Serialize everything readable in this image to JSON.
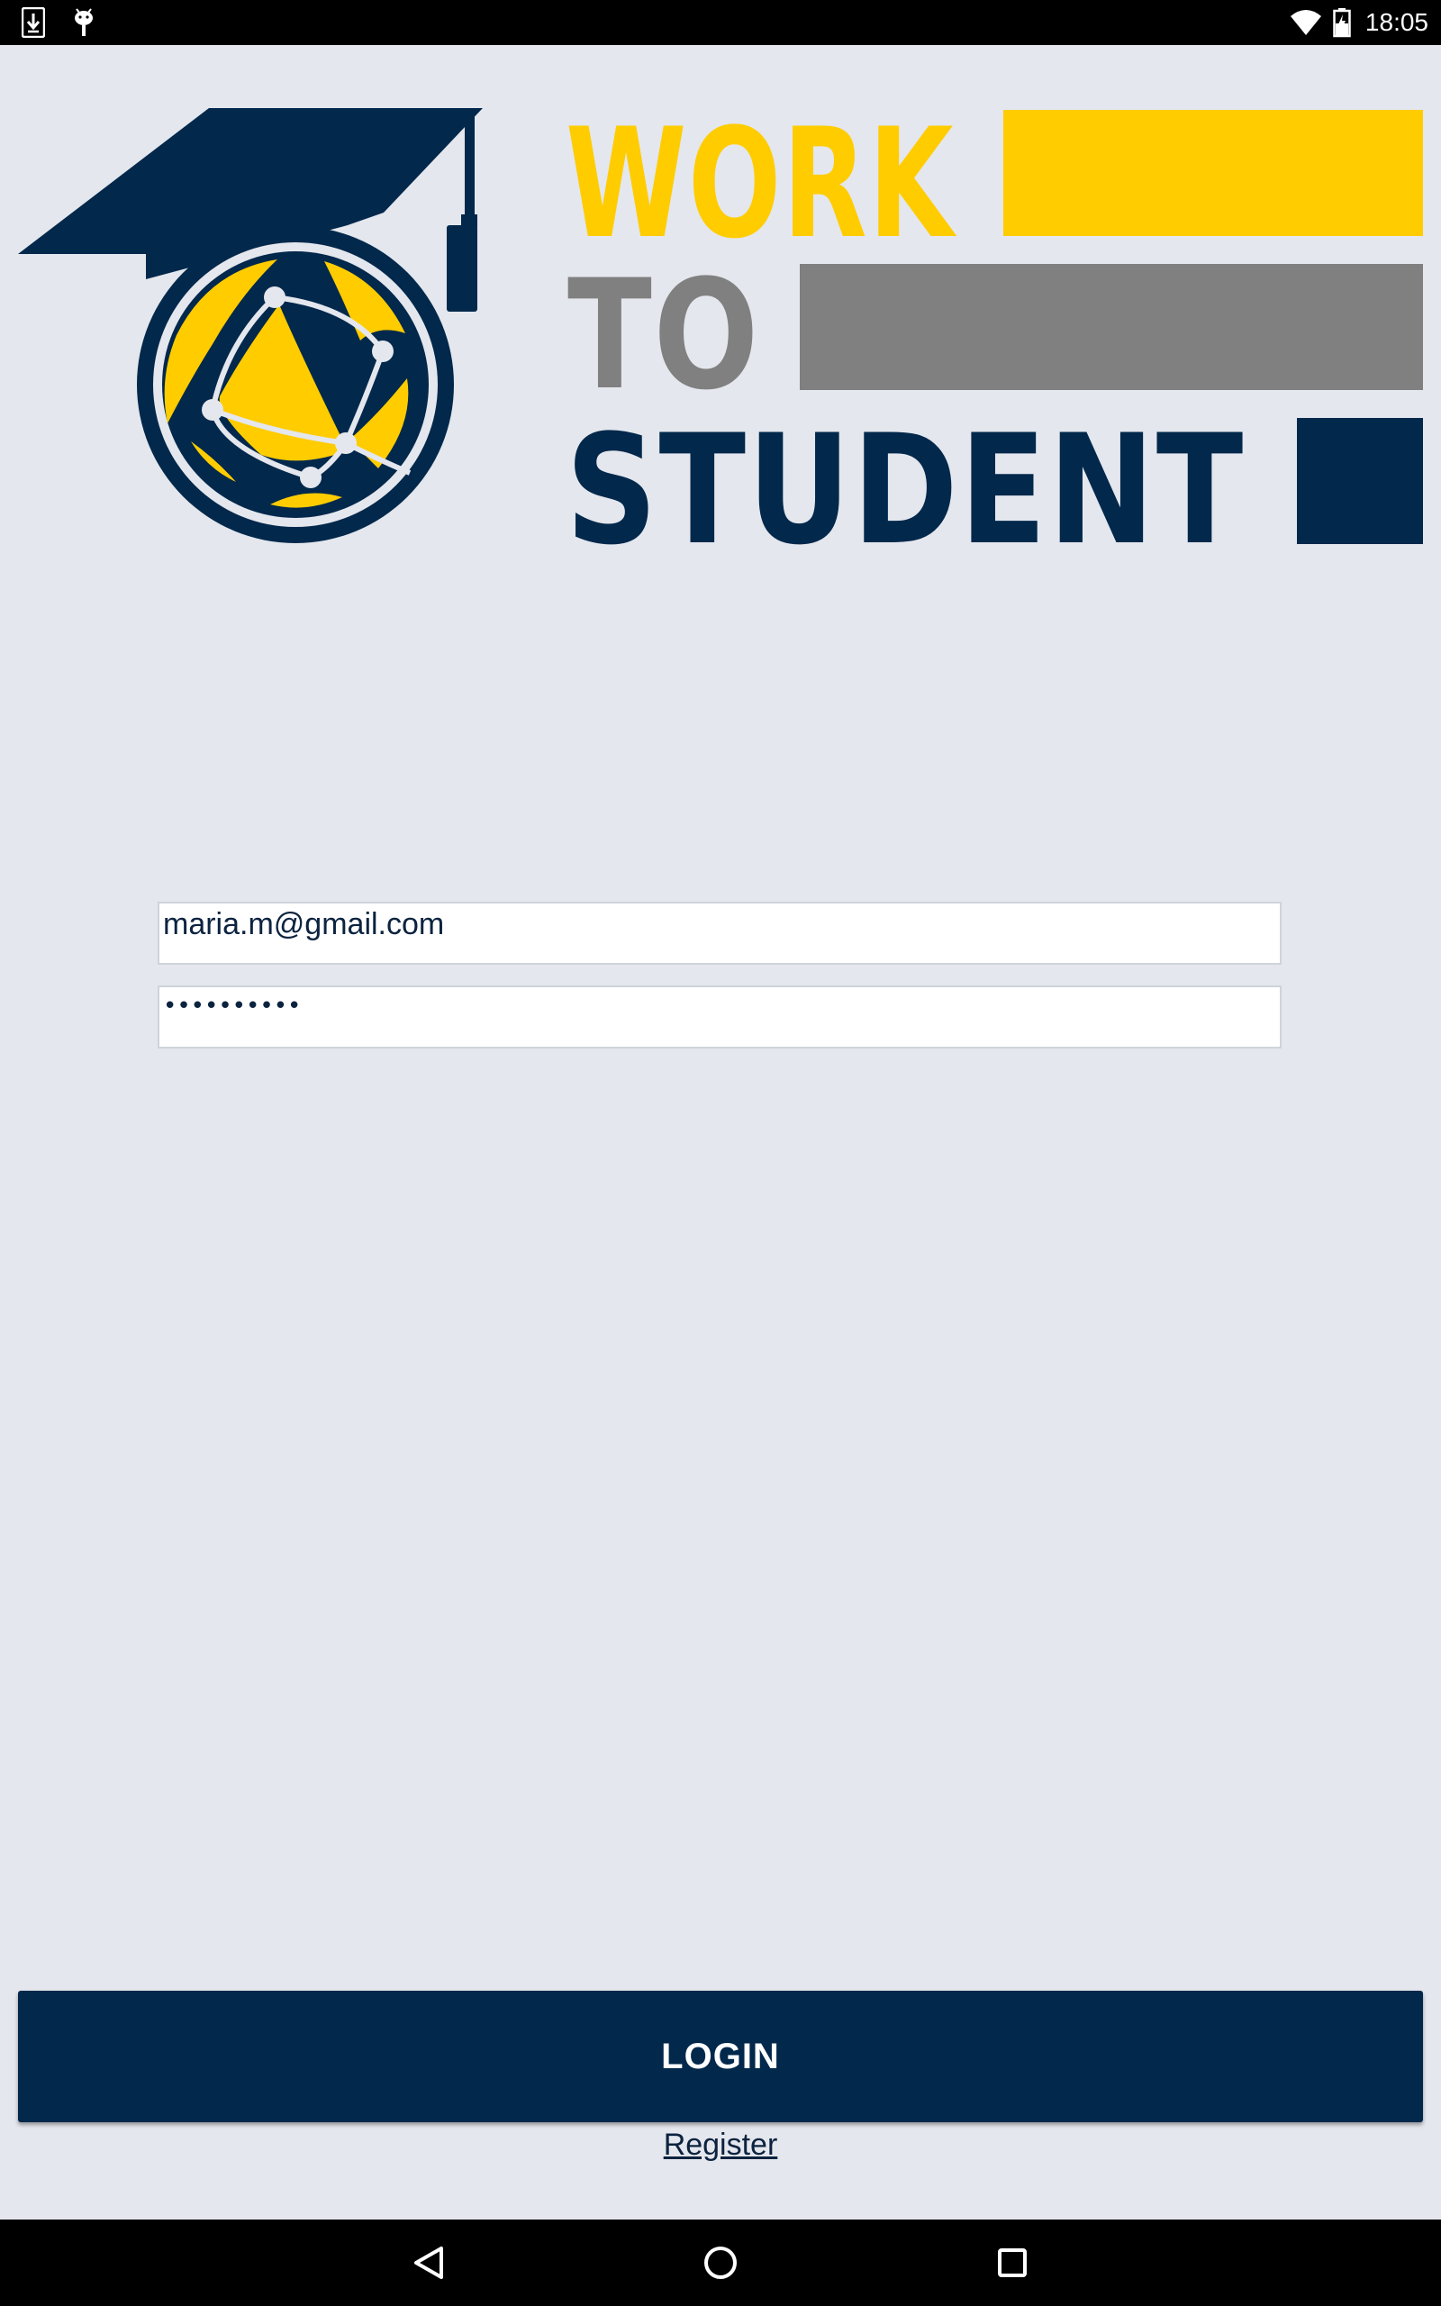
{
  "status_bar": {
    "time": "18:05",
    "left_icons": [
      "download-icon",
      "android-debug-icon"
    ],
    "right_icons": [
      "wifi-icon",
      "battery-charging-icon"
    ]
  },
  "logo": {
    "line1": "WORK",
    "line2": "TO",
    "line3": "STUDENT",
    "colors": {
      "navy": "#02284c",
      "yellow": "#ffcc00",
      "gray": "#808080"
    }
  },
  "login_form": {
    "email_value": "maria.m@gmail.com",
    "password_value": "••••••••••"
  },
  "actions": {
    "login_label": "LOGIN",
    "register_label": "Register"
  },
  "nav_bar": {
    "buttons": [
      "back-icon",
      "home-icon",
      "recents-icon"
    ]
  }
}
